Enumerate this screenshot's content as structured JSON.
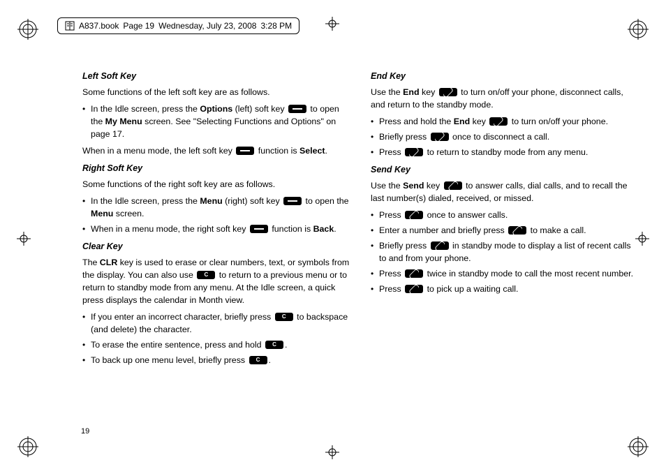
{
  "header": {
    "file": "A837.book",
    "page_label": "Page 19",
    "date": "Wednesday, July 23, 2008",
    "time": "3:28 PM"
  },
  "page_number": "19",
  "left": {
    "s1": {
      "title": "Left Soft Key",
      "intro": "Some functions of the left soft key are as follows.",
      "b1a": "In the Idle screen, press the ",
      "b1b": "Options",
      "b1c": " (left) soft key ",
      "b1d": " to open the ",
      "b1e": "My Menu",
      "b1f": " screen. See \"Selecting Functions and Options\" on page 17.",
      "p2a": "When in a menu mode, the left soft key ",
      "p2b": " function is ",
      "p2c": "Select",
      "p2d": "."
    },
    "s2": {
      "title": "Right Soft Key",
      "intro": "Some functions of the right soft key are as follows.",
      "b1a": "In the Idle screen, press the ",
      "b1b": "Menu",
      "b1c": " (right) soft key ",
      "b1d": " to open the ",
      "b1e": "Menu",
      "b1f": " screen.",
      "b2a": "When in a menu mode, the right soft key ",
      "b2b": " function is ",
      "b2c": "Back",
      "b2d": "."
    },
    "s3": {
      "title": "Clear Key",
      "p1a": "The ",
      "p1b": "CLR",
      "p1c": " key is used to erase or clear numbers, text, or symbols from the display. You can also use ",
      "p1d": " to return to a previous menu or to return to standby mode from any menu. At the Idle screen, a quick press displays the calendar in Month view.",
      "b1a": "If you enter an incorrect character, briefly press ",
      "b1b": " to backspace (and delete) the character.",
      "b2a": "To erase the entire sentence, press and hold ",
      "b2b": ".",
      "b3a": "To back up one menu level, briefly press ",
      "b3b": "."
    }
  },
  "right": {
    "s1": {
      "title": "End Key",
      "p1a": "Use the ",
      "p1b": "End",
      "p1c": " key ",
      "p1d": " to turn on/off your phone, disconnect calls, and return to the standby mode.",
      "b1a": "Press and hold the ",
      "b1b": "End",
      "b1c": " key ",
      "b1d": " to turn on/off your phone.",
      "b2a": "Briefly press ",
      "b2b": " once to disconnect a call.",
      "b3a": "Press ",
      "b3b": " to return to standby mode from any menu."
    },
    "s2": {
      "title": "Send Key",
      "p1a": "Use the ",
      "p1b": "Send",
      "p1c": " key ",
      "p1d": " to answer calls, dial calls, and to recall the last number(s) dialed, received, or missed.",
      "b1a": "Press ",
      "b1b": " once to answer calls.",
      "b2a": "Enter a number and briefly press ",
      "b2b": " to make a call.",
      "b3a": "Briefly press ",
      "b3b": " in standby mode to display a list of recent calls to and from your phone.",
      "b4a": "Press ",
      "b4b": " twice in standby mode to call the most recent number.",
      "b5a": "Press ",
      "b5b": " to pick up a waiting call."
    }
  }
}
